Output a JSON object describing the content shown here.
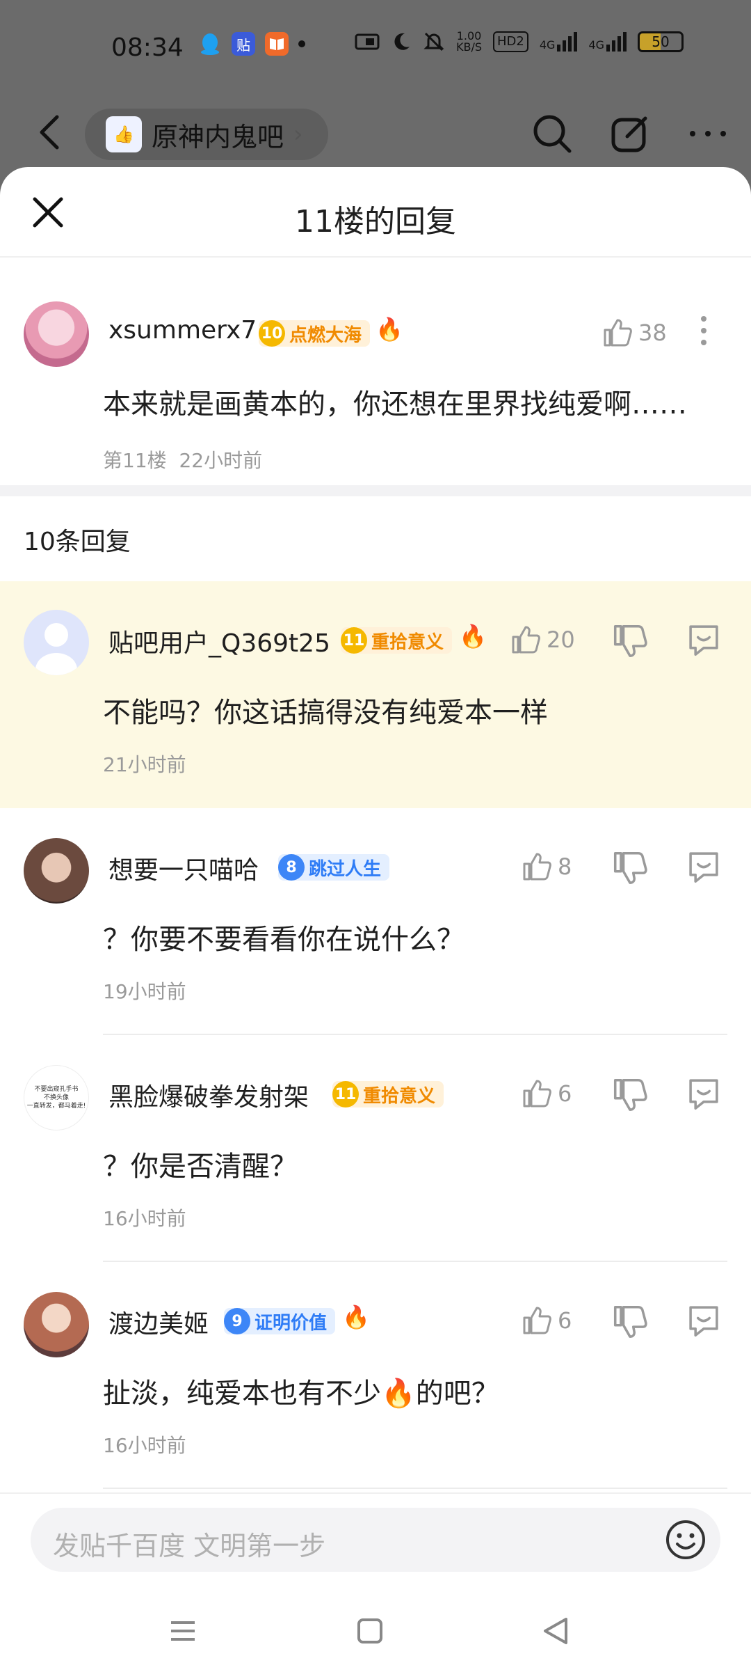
{
  "status": {
    "time": "08:34",
    "net_speed": "1.00\nKB/S",
    "hd": "HD2",
    "signal1": "4G",
    "signal2": "4G",
    "battery": "50",
    "tieba_icon": "贴"
  },
  "nav": {
    "forum_name": "原神内鬼吧",
    "back_icon": "back-arrow-icon",
    "search_icon": "search-icon",
    "edit_icon": "edit-icon",
    "more_icon": "more-dots-icon"
  },
  "sheet": {
    "title": "11楼的回复"
  },
  "main_post": {
    "username": "xsummerx7",
    "badge_level": "10",
    "badge_text": "点燃大海",
    "fire": "🔥",
    "likes": "38",
    "content": "本来就是画黄本的，你还想在里界找纯爱啊……",
    "floor": "第11楼",
    "time": "22小时前"
  },
  "reply_count": "10条回复",
  "replies": [
    {
      "username": "贴吧用户_Q369t25",
      "badge_level": "11",
      "badge_text": "重拾意义",
      "badge_color": "orange",
      "fire": "🔥",
      "likes": "20",
      "content": "不能吗？你这话搞得没有纯爱本一样",
      "time": "21小时前"
    },
    {
      "username": "想要一只喵哈",
      "badge_level": "8",
      "badge_text": "跳过人生",
      "badge_color": "blue",
      "fire": "",
      "likes": "8",
      "content": "？你要不要看看你在说什么？",
      "time": "19小时前"
    },
    {
      "username": "黑脸爆破拳发射架",
      "badge_level": "11",
      "badge_text": "重拾意义",
      "badge_color": "orange",
      "fire": "",
      "likes": "6",
      "content": "？你是否清醒？",
      "time": "16小时前"
    },
    {
      "username": "渡边美姬",
      "badge_level": "9",
      "badge_text": "证明价值",
      "badge_color": "blue",
      "fire": "🔥",
      "likes": "6",
      "content": "扯淡，纯爱本也有不少🔥的吧？",
      "time": "16小时前"
    }
  ],
  "avatar3_text": "不要出窥孔手书\n不换头像\n一直转发，都马着走!",
  "input": {
    "placeholder": "发贴千百度 文明第一步"
  },
  "colors": {
    "highlight_bg": "#fdf9e3",
    "badge_orange": "#f08a00",
    "badge_blue": "#2e7cf6"
  }
}
